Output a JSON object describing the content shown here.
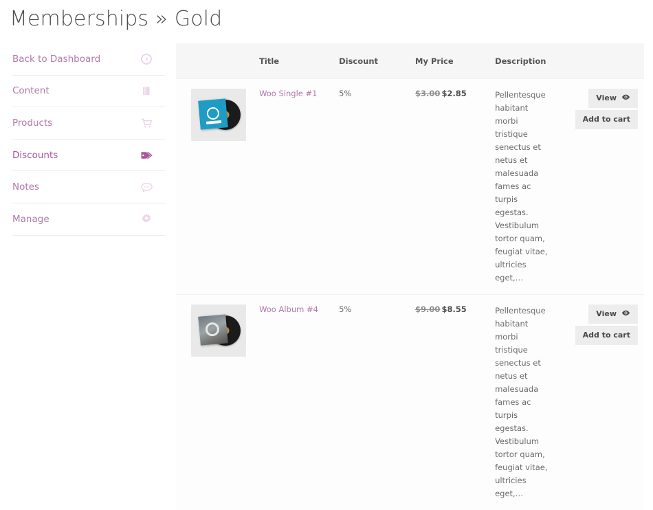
{
  "page": {
    "title": "Memberships » Gold",
    "breadcrumb_parent": "Memberships",
    "breadcrumb_separator": "»",
    "breadcrumb_current": "Gold"
  },
  "colors": {
    "link": "#b07aa8",
    "active_link": "#a8559c",
    "icon_muted": "#ecd5e8",
    "header_bg": "#f6f6f6",
    "button_bg": "#ededed"
  },
  "sidebar": {
    "items": [
      {
        "label": "Back to Dashboard",
        "icon": "back-circle-icon",
        "active": false
      },
      {
        "label": "Content",
        "icon": "book-icon",
        "active": false
      },
      {
        "label": "Products",
        "icon": "cart-icon",
        "active": false
      },
      {
        "label": "Discounts",
        "icon": "tag-icon",
        "active": true
      },
      {
        "label": "Notes",
        "icon": "speech-bubble-icon",
        "active": false
      },
      {
        "label": "Manage",
        "icon": "gear-icon",
        "active": false
      }
    ]
  },
  "table": {
    "columns": [
      "",
      "Title",
      "Discount",
      "My Price",
      "Description",
      ""
    ],
    "headers": {
      "thumbnail": "",
      "title": "Title",
      "discount": "Discount",
      "my_price": "My Price",
      "description": "Description",
      "actions": ""
    },
    "rows": [
      {
        "thumbnail": "vinyl-record-blue-sleeve",
        "title": "Woo Single #1",
        "discount": "5%",
        "price_old": "$3.00",
        "price_new": "$2.85",
        "description": "Pellentesque habitant morbi tristique senectus et netus et malesuada fames ac turpis egestas. Vestibulum tortor quam, feugiat vitae, ultricies eget,…",
        "view_label": "View",
        "view_icon": "eye-icon",
        "add_to_cart_label": "Add to cart"
      },
      {
        "thumbnail": "vinyl-record-grey-sleeve",
        "title": "Woo Album #4",
        "discount": "5%",
        "price_old": "$9.00",
        "price_new": "$8.55",
        "description": "Pellentesque habitant morbi tristique senectus et netus et malesuada fames ac turpis egestas. Vestibulum tortor quam, feugiat vitae, ultricies eget,…",
        "view_label": "View",
        "view_icon": "eye-icon",
        "add_to_cart_label": "Add to cart"
      }
    ]
  }
}
